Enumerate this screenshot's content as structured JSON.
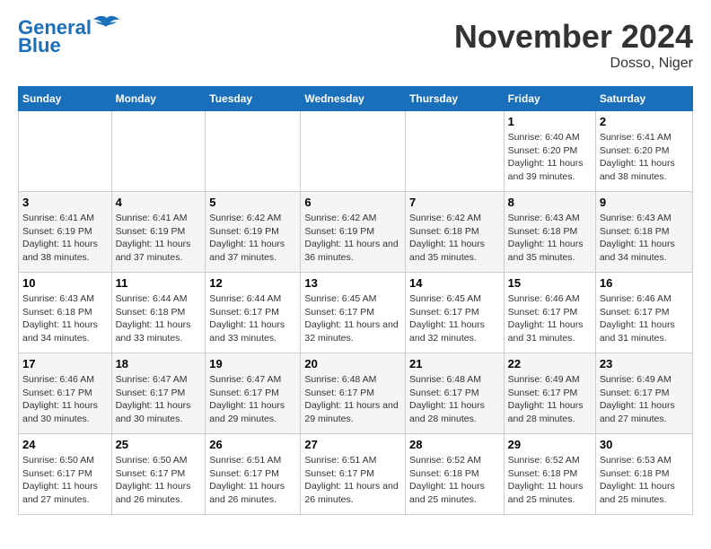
{
  "logo": {
    "line1": "General",
    "line2": "Blue"
  },
  "title": "November 2024",
  "subtitle": "Dosso, Niger",
  "days_of_week": [
    "Sunday",
    "Monday",
    "Tuesday",
    "Wednesday",
    "Thursday",
    "Friday",
    "Saturday"
  ],
  "weeks": [
    [
      {
        "day": "",
        "info": ""
      },
      {
        "day": "",
        "info": ""
      },
      {
        "day": "",
        "info": ""
      },
      {
        "day": "",
        "info": ""
      },
      {
        "day": "",
        "info": ""
      },
      {
        "day": "1",
        "info": "Sunrise: 6:40 AM\nSunset: 6:20 PM\nDaylight: 11 hours and 39 minutes."
      },
      {
        "day": "2",
        "info": "Sunrise: 6:41 AM\nSunset: 6:20 PM\nDaylight: 11 hours and 38 minutes."
      }
    ],
    [
      {
        "day": "3",
        "info": "Sunrise: 6:41 AM\nSunset: 6:19 PM\nDaylight: 11 hours and 38 minutes."
      },
      {
        "day": "4",
        "info": "Sunrise: 6:41 AM\nSunset: 6:19 PM\nDaylight: 11 hours and 37 minutes."
      },
      {
        "day": "5",
        "info": "Sunrise: 6:42 AM\nSunset: 6:19 PM\nDaylight: 11 hours and 37 minutes."
      },
      {
        "day": "6",
        "info": "Sunrise: 6:42 AM\nSunset: 6:19 PM\nDaylight: 11 hours and 36 minutes."
      },
      {
        "day": "7",
        "info": "Sunrise: 6:42 AM\nSunset: 6:18 PM\nDaylight: 11 hours and 35 minutes."
      },
      {
        "day": "8",
        "info": "Sunrise: 6:43 AM\nSunset: 6:18 PM\nDaylight: 11 hours and 35 minutes."
      },
      {
        "day": "9",
        "info": "Sunrise: 6:43 AM\nSunset: 6:18 PM\nDaylight: 11 hours and 34 minutes."
      }
    ],
    [
      {
        "day": "10",
        "info": "Sunrise: 6:43 AM\nSunset: 6:18 PM\nDaylight: 11 hours and 34 minutes."
      },
      {
        "day": "11",
        "info": "Sunrise: 6:44 AM\nSunset: 6:18 PM\nDaylight: 11 hours and 33 minutes."
      },
      {
        "day": "12",
        "info": "Sunrise: 6:44 AM\nSunset: 6:17 PM\nDaylight: 11 hours and 33 minutes."
      },
      {
        "day": "13",
        "info": "Sunrise: 6:45 AM\nSunset: 6:17 PM\nDaylight: 11 hours and 32 minutes."
      },
      {
        "day": "14",
        "info": "Sunrise: 6:45 AM\nSunset: 6:17 PM\nDaylight: 11 hours and 32 minutes."
      },
      {
        "day": "15",
        "info": "Sunrise: 6:46 AM\nSunset: 6:17 PM\nDaylight: 11 hours and 31 minutes."
      },
      {
        "day": "16",
        "info": "Sunrise: 6:46 AM\nSunset: 6:17 PM\nDaylight: 11 hours and 31 minutes."
      }
    ],
    [
      {
        "day": "17",
        "info": "Sunrise: 6:46 AM\nSunset: 6:17 PM\nDaylight: 11 hours and 30 minutes."
      },
      {
        "day": "18",
        "info": "Sunrise: 6:47 AM\nSunset: 6:17 PM\nDaylight: 11 hours and 30 minutes."
      },
      {
        "day": "19",
        "info": "Sunrise: 6:47 AM\nSunset: 6:17 PM\nDaylight: 11 hours and 29 minutes."
      },
      {
        "day": "20",
        "info": "Sunrise: 6:48 AM\nSunset: 6:17 PM\nDaylight: 11 hours and 29 minutes."
      },
      {
        "day": "21",
        "info": "Sunrise: 6:48 AM\nSunset: 6:17 PM\nDaylight: 11 hours and 28 minutes."
      },
      {
        "day": "22",
        "info": "Sunrise: 6:49 AM\nSunset: 6:17 PM\nDaylight: 11 hours and 28 minutes."
      },
      {
        "day": "23",
        "info": "Sunrise: 6:49 AM\nSunset: 6:17 PM\nDaylight: 11 hours and 27 minutes."
      }
    ],
    [
      {
        "day": "24",
        "info": "Sunrise: 6:50 AM\nSunset: 6:17 PM\nDaylight: 11 hours and 27 minutes."
      },
      {
        "day": "25",
        "info": "Sunrise: 6:50 AM\nSunset: 6:17 PM\nDaylight: 11 hours and 26 minutes."
      },
      {
        "day": "26",
        "info": "Sunrise: 6:51 AM\nSunset: 6:17 PM\nDaylight: 11 hours and 26 minutes."
      },
      {
        "day": "27",
        "info": "Sunrise: 6:51 AM\nSunset: 6:17 PM\nDaylight: 11 hours and 26 minutes."
      },
      {
        "day": "28",
        "info": "Sunrise: 6:52 AM\nSunset: 6:18 PM\nDaylight: 11 hours and 25 minutes."
      },
      {
        "day": "29",
        "info": "Sunrise: 6:52 AM\nSunset: 6:18 PM\nDaylight: 11 hours and 25 minutes."
      },
      {
        "day": "30",
        "info": "Sunrise: 6:53 AM\nSunset: 6:18 PM\nDaylight: 11 hours and 25 minutes."
      }
    ]
  ]
}
